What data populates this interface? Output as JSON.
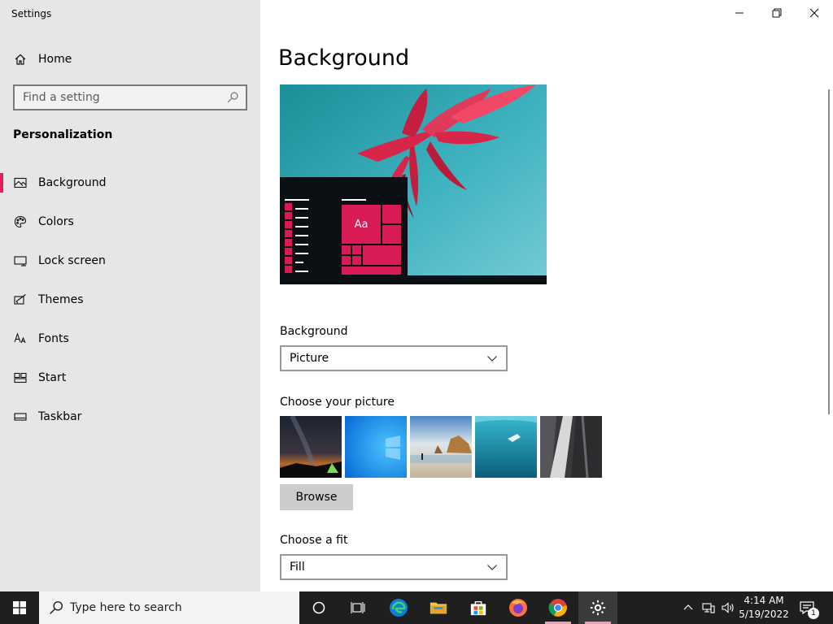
{
  "window": {
    "app_title": "Settings",
    "controls": {
      "minimize": "minimize-icon",
      "restore": "restore-icon",
      "close": "close-icon"
    }
  },
  "sidebar": {
    "home_label": "Home",
    "search_placeholder": "Find a setting",
    "section_title": "Personalization",
    "items": [
      {
        "label": "Background",
        "icon": "picture-icon",
        "active": true
      },
      {
        "label": "Colors",
        "icon": "palette-icon",
        "active": false
      },
      {
        "label": "Lock screen",
        "icon": "lock-screen-icon",
        "active": false
      },
      {
        "label": "Themes",
        "icon": "brush-icon",
        "active": false
      },
      {
        "label": "Fonts",
        "icon": "fonts-icon",
        "active": false
      },
      {
        "label": "Start",
        "icon": "start-tiles-icon",
        "active": false
      },
      {
        "label": "Taskbar",
        "icon": "taskbar-icon",
        "active": false
      }
    ]
  },
  "main": {
    "title": "Background",
    "preview_tile_text": "Aa",
    "background_label": "Background",
    "background_value": "Picture",
    "choose_picture_label": "Choose your picture",
    "thumbnails": [
      "night-sky-tent",
      "windows-blue",
      "beach-rocks",
      "underwater-swimmer",
      "waterfall-cliff"
    ],
    "browse_label": "Browse",
    "fit_label": "Choose a fit",
    "fit_value": "Fill"
  },
  "taskbar": {
    "search_placeholder": "Type here to search",
    "apps": [
      "cortana-icon",
      "task-view-icon",
      "edge-icon",
      "file-explorer-icon",
      "store-icon",
      "firefox-icon",
      "chrome-icon",
      "settings-icon"
    ],
    "time": "4:14 AM",
    "date": "5/19/2022",
    "notification_count": "1"
  },
  "colors": {
    "accent": "#e81e5a",
    "sidebar_bg": "#e6e6e6",
    "taskbar_bg": "#1f1f1f"
  }
}
